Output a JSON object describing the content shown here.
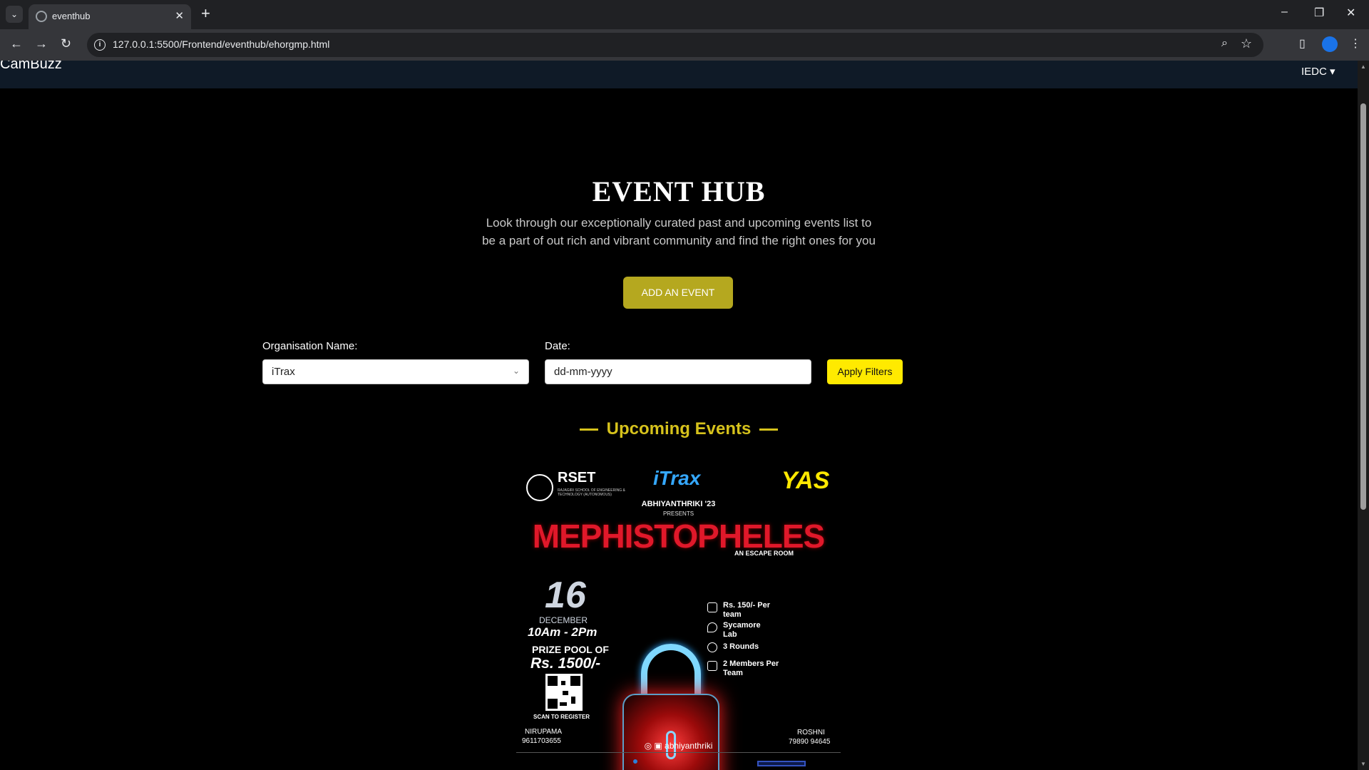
{
  "browser": {
    "tab_title": "eventhub",
    "url": "127.0.0.1:5500/Frontend/eventhub/ehorgmp.html",
    "icons": [
      "tab-list-icon",
      "favicon-icon",
      "close-icon",
      "new-tab-icon",
      "minimize-icon",
      "restore-icon",
      "close-window-icon",
      "back-icon",
      "forward-icon",
      "reload-icon",
      "info-icon",
      "zoom-icon",
      "star-icon",
      "side-panel-icon",
      "extension-icon",
      "menu-icon"
    ]
  },
  "navbar": {
    "brand": "CamBuzz",
    "dropdown_label": "IEDC ▾"
  },
  "hero": {
    "title": "EVENT HUB",
    "subtitle": "Look through our exceptionally curated past and upcoming events list to be a part of out rich and vibrant community and find the right ones for you",
    "add_event_label": "ADD AN EVENT"
  },
  "filters": {
    "org_label": "Organisation Name:",
    "org_value": "iTrax",
    "date_label": "Date:",
    "date_placeholder": "dd-mm-yyyy",
    "apply_label": "Apply Filters"
  },
  "section": {
    "upcoming_title": "Upcoming Events"
  },
  "poster": {
    "rset": "RSET",
    "rset_sub": "RAJAGIRI SCHOOL OF ENGINEERING & TECHNOLOGY (AUTONOMOUS)",
    "itrax": "iTrax",
    "yas": "YAS",
    "abhiyanthriki": "ABHIYANTHRIKI '23",
    "presents": "PRESENTS",
    "title": "MEPHISTOPHELES",
    "subtitle": "AN ESCAPE ROOM",
    "day": "16",
    "month": "DECEMBER",
    "time": "10Am - 2Pm",
    "prize_line1": "PRIZE POOL OF",
    "prize_line2": "Rs. 1500/-",
    "scan": "SCAN TO REGISTER",
    "fee": "Rs. 150/- Per team",
    "venue": "Sycamore Lab",
    "rounds": "3 Rounds",
    "members": "2 Members Per Team",
    "contact1_name": "NIRUPAMA",
    "contact1_phone": "9611703655",
    "contact2_name": "ROSHNI",
    "contact2_phone": "79890 94645",
    "instagram": "abhiyanthriki"
  }
}
